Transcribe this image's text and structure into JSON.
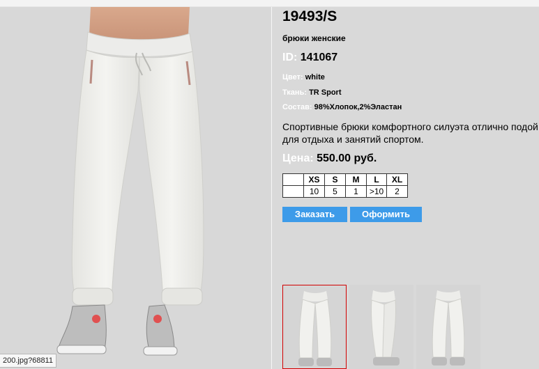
{
  "product": {
    "sku": "19493/S",
    "type": "брюки женские",
    "id_label": "ID:",
    "id_value": "141067",
    "color_label": "Цвет:",
    "color_value": "white",
    "fabric_label": "Ткань:",
    "fabric_value": "TR Sport",
    "composition_label": "Состав:",
    "composition_value": "98%Хлопок,2%Эластан",
    "description": "Спортивные брюки комфортного силуэта отлично подой\nдля отдыха и занятий спортом.",
    "price_label": "Цена:",
    "price_value": "550.00 руб."
  },
  "sizes": {
    "headers": [
      "",
      "XS",
      "S",
      "M",
      "L",
      "XL"
    ],
    "stock": [
      "",
      "10",
      "5",
      "1",
      ">10",
      "2"
    ]
  },
  "buttons": {
    "order": "Заказать",
    "checkout": "Оформить"
  },
  "status_tip": "200.jpg?68811",
  "colors": {
    "background": "#d9d9d9",
    "button": "#3d9be9",
    "label": "#ffffff",
    "thumb_active_border": "#d20000"
  },
  "thumbnails": [
    {
      "view": "front",
      "active": true
    },
    {
      "view": "side",
      "active": false
    },
    {
      "view": "back",
      "active": false
    }
  ]
}
